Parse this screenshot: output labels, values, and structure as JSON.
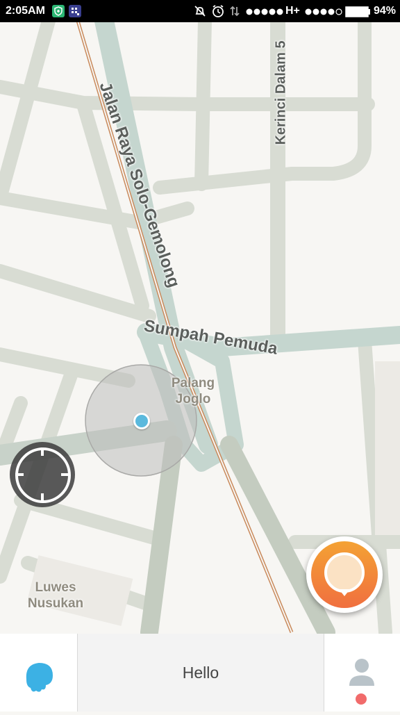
{
  "status_bar": {
    "time": "2:05AM",
    "network": "H+",
    "battery_percent": "94%",
    "notification_icons": [
      "shield-app-icon",
      "bbm-icon"
    ],
    "system_icons": [
      "notifications-off-icon",
      "alarm-icon",
      "data-transfer-icon",
      "signal-dots-icon",
      "battery-icon"
    ]
  },
  "map": {
    "roads": {
      "main_road": "Jalan Raya Solo-Gemolong",
      "cross_road": "Sumpah Pemuda",
      "side_road": "Kerinci Dalam 5"
    },
    "places": {
      "palang_line1": "Palang",
      "palang_line2": "Joglo",
      "luwes_line1": "Luwes",
      "luwes_line2": "Nusukan"
    },
    "colors": {
      "background": "#f7f6f3",
      "minor_road": "#d8dcd3",
      "major_road": "#c5d6cf",
      "railway": "#c98a5c",
      "location_dot": "#5bb9dd",
      "accuracy_circle": "#bdbdbb"
    }
  },
  "controls": {
    "recenter_icon": "crosshair-icon",
    "report_icon": "report-pin-icon",
    "report_colors": {
      "top": "#f4a234",
      "bottom": "#f06f3f"
    }
  },
  "bottom_bar": {
    "menu_icon": "wazer-icon",
    "greeting": "Hello",
    "profile_icon": "user-icon",
    "notification_color": "#f16b6b"
  }
}
